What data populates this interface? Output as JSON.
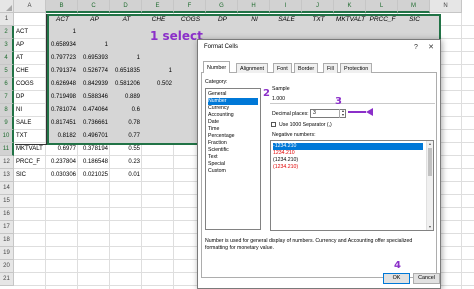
{
  "sheet": {
    "columns": [
      "A",
      "B",
      "C",
      "D",
      "E",
      "F",
      "G",
      "H",
      "I",
      "J",
      "K",
      "L",
      "M",
      "N"
    ],
    "rows": [
      "1",
      "2",
      "3",
      "4",
      "5",
      "6",
      "7",
      "8",
      "9",
      "10",
      "11",
      "12",
      "13",
      "14",
      "15",
      "16",
      "17",
      "18",
      "19",
      "20",
      "21"
    ],
    "header_row": [
      "ACT",
      "AP",
      "AT",
      "CHE",
      "COGS",
      "DP",
      "NI",
      "SALE",
      "TXT",
      "MKTVALT",
      "PRCC_F",
      "SIC"
    ],
    "row_labels": [
      "ACT",
      "AP",
      "AT",
      "CHE",
      "COGS",
      "DP",
      "NI",
      "SALE",
      "TXT",
      "MKTVALT",
      "PRCC_F",
      "SIC"
    ],
    "matrix": [
      [
        "1"
      ],
      [
        "0.658934",
        "1"
      ],
      [
        "0.797723",
        "0.695393",
        "1"
      ],
      [
        "0.791374",
        "0.526774",
        "0.651835",
        "1"
      ],
      [
        "0.626948",
        "0.842939",
        "0.581206",
        "0.502"
      ],
      [
        "0.719498",
        "0.588346",
        "0.889"
      ],
      [
        "0.781074",
        "0.474064",
        "0.6"
      ],
      [
        "0.817451",
        "0.736661",
        "0.78"
      ],
      [
        "0.8182",
        "0.496701",
        "0.77"
      ],
      [
        "0.6977",
        "0.378194",
        "0.55"
      ],
      [
        "0.237804",
        "0.186548",
        "0.23"
      ],
      [
        "0.030306",
        "0.021025",
        "0.01"
      ]
    ]
  },
  "annotations": {
    "step1": "1 select",
    "step2": "2",
    "step3": "3",
    "step4": "4"
  },
  "dialog": {
    "title": "Format Cells",
    "help_label": "?",
    "close_label": "✕",
    "tabs": [
      "Number",
      "Alignment",
      "Font",
      "Border",
      "Fill",
      "Protection"
    ],
    "category_label": "Category:",
    "categories": [
      "General",
      "Number",
      "Currency",
      "Accounting",
      "Date",
      "Time",
      "Percentage",
      "Fraction",
      "Scientific",
      "Text",
      "Special",
      "Custom"
    ],
    "selected_category": "Number",
    "sample_label": "Sample",
    "sample_value": "1.000",
    "decimal_places_label": "Decimal places:",
    "decimal_places_value": "3",
    "separator_label": "Use 1000 Separator (,)",
    "negative_label": "Negative numbers:",
    "negative_options": [
      "-1234.210",
      "1234.210",
      "(1234.210)",
      "(1234.210)"
    ],
    "negative_colors": [
      "#ffffff",
      "#e00000",
      "#000000",
      "#e00000"
    ],
    "description": "Number is used for general display of numbers. Currency and Accounting offer specialized formatting for monetary value.",
    "ok_label": "OK",
    "cancel_label": "Cancel"
  },
  "colors": {
    "excel_green": "#217346",
    "annotation_purple": "#8b2fc9",
    "selection_blue": "#0078d7",
    "negative_red": "#e00000"
  }
}
